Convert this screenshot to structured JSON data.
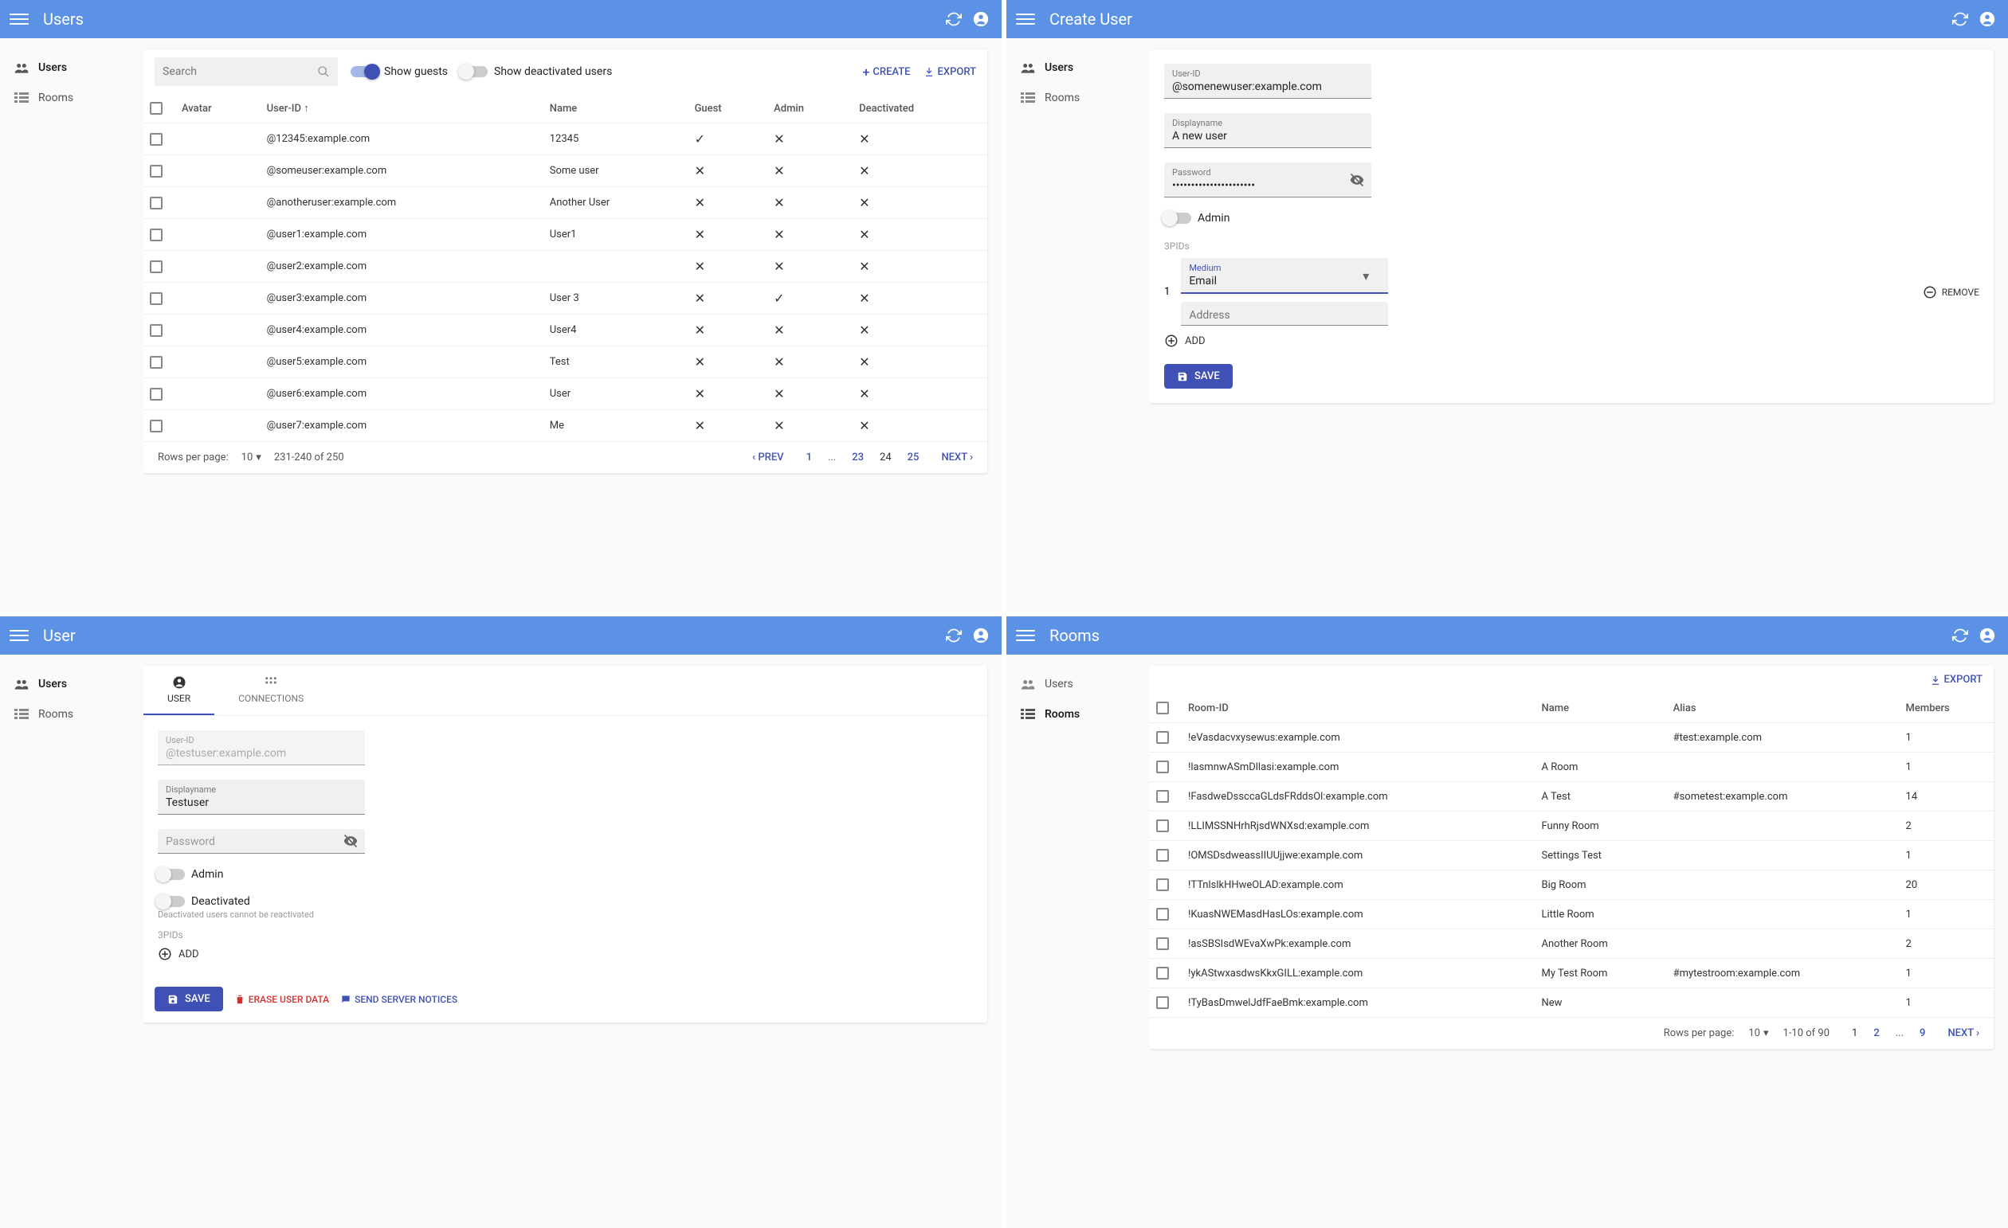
{
  "panels": {
    "users": {
      "title": "Users",
      "sidebar": {
        "users": "Users",
        "rooms": "Rooms"
      },
      "search_placeholder": "Search",
      "toggle_guests": "Show guests",
      "toggle_deactivated": "Show deactivated users",
      "create_btn": "CREATE",
      "export_btn": "EXPORT",
      "columns": {
        "avatar": "Avatar",
        "userid": "User-ID",
        "name": "Name",
        "guest": "Guest",
        "admin": "Admin",
        "deactivated": "Deactivated"
      },
      "rows": [
        {
          "id": "@12345:example.com",
          "name": "12345",
          "guest": true,
          "admin": false,
          "deactivated": false
        },
        {
          "id": "@someuser:example.com",
          "name": "Some user",
          "guest": false,
          "admin": false,
          "deactivated": false
        },
        {
          "id": "@anotheruser:example.com",
          "name": "Another User",
          "guest": false,
          "admin": false,
          "deactivated": false
        },
        {
          "id": "@user1:example.com",
          "name": "User1",
          "guest": false,
          "admin": false,
          "deactivated": false
        },
        {
          "id": "@user2:example.com",
          "name": "",
          "guest": false,
          "admin": false,
          "deactivated": false
        },
        {
          "id": "@user3:example.com",
          "name": "User 3",
          "guest": false,
          "admin": true,
          "deactivated": false
        },
        {
          "id": "@user4:example.com",
          "name": "User4",
          "guest": false,
          "admin": false,
          "deactivated": false
        },
        {
          "id": "@user5:example.com",
          "name": "Test",
          "guest": false,
          "admin": false,
          "deactivated": false
        },
        {
          "id": "@user6:example.com",
          "name": "User",
          "guest": false,
          "admin": false,
          "deactivated": false
        },
        {
          "id": "@user7:example.com",
          "name": "Me",
          "guest": false,
          "admin": false,
          "deactivated": false
        }
      ],
      "pager": {
        "rpp_label": "Rows per page:",
        "rpp": "10",
        "range": "231-240 of 250",
        "prev": "PREV",
        "next": "NEXT",
        "pages": [
          "1",
          "...",
          "23",
          "24",
          "25"
        ],
        "current": "24"
      }
    },
    "create": {
      "title": "Create User",
      "sidebar": {
        "users": "Users",
        "rooms": "Rooms"
      },
      "userid_label": "User-ID",
      "userid_value": "@somenewuser:example.com",
      "displayname_label": "Displayname",
      "displayname_value": "A new user",
      "password_label": "Password",
      "password_value": "••••••••••••••••••••••",
      "admin_label": "Admin",
      "threepids_label": "3PIDs",
      "medium_label": "Medium",
      "medium_value": "Email",
      "address_placeholder": "Address",
      "remove_label": "REMOVE",
      "add_label": "ADD",
      "save_label": "SAVE",
      "row_index": "1"
    },
    "user": {
      "title": "User",
      "sidebar": {
        "users": "Users",
        "rooms": "Rooms"
      },
      "tabs": {
        "user": "USER",
        "connections": "CONNECTIONS"
      },
      "userid_label": "User-ID",
      "userid_value": "@testuser:example.com",
      "displayname_label": "Displayname",
      "displayname_value": "Testuser",
      "password_label": "Password",
      "admin_label": "Admin",
      "deactivated_label": "Deactivated",
      "deactivated_note": "Deactivated users cannot be reactivated",
      "threepids_label": "3PIDs",
      "add_label": "ADD",
      "save_label": "SAVE",
      "erase_label": "ERASE USER DATA",
      "notice_label": "SEND SERVER NOTICES"
    },
    "rooms": {
      "title": "Rooms",
      "sidebar": {
        "users": "Users",
        "rooms": "Rooms"
      },
      "export_btn": "EXPORT",
      "columns": {
        "roomid": "Room-ID",
        "name": "Name",
        "alias": "Alias",
        "members": "Members"
      },
      "rows": [
        {
          "id": "!eVasdacvxysewus:example.com",
          "name": "",
          "alias": "#test:example.com",
          "members": "1"
        },
        {
          "id": "!lasmnwASmDllasi:example.com",
          "name": "A Room",
          "alias": "",
          "members": "1"
        },
        {
          "id": "!FasdweDssccaGLdsFRddsOl:example.com",
          "name": "A Test",
          "alias": "#sometest:example.com",
          "members": "14"
        },
        {
          "id": "!LLIMSSNHrhRjsdWNXsd:example.com",
          "name": "Funny Room",
          "alias": "",
          "members": "2"
        },
        {
          "id": "!OMSDsdweassIIUUjjwe:example.com",
          "name": "Settings Test",
          "alias": "",
          "members": "1"
        },
        {
          "id": "!TTnlslkHHweOLAD:example.com",
          "name": "Big Room",
          "alias": "",
          "members": "20"
        },
        {
          "id": "!KuasNWEMasdHasLOs:example.com",
          "name": "Little Room",
          "alias": "",
          "members": "1"
        },
        {
          "id": "!asSBSIsdWEvaXwPk:example.com",
          "name": "Another Room",
          "alias": "",
          "members": "2"
        },
        {
          "id": "!ykAStwxasdwsKkxGILL:example.com",
          "name": "My Test Room",
          "alias": "#mytestroom:example.com",
          "members": "1"
        },
        {
          "id": "!TyBasDmwelJdfFaeBmk:example.com",
          "name": "New",
          "alias": "",
          "members": "1"
        }
      ],
      "pager": {
        "rpp_label": "Rows per page:",
        "rpp": "10",
        "range": "1-10 of 90",
        "next": "NEXT",
        "pages": [
          "1",
          "2",
          "...",
          "9"
        ],
        "current": "1"
      }
    }
  }
}
